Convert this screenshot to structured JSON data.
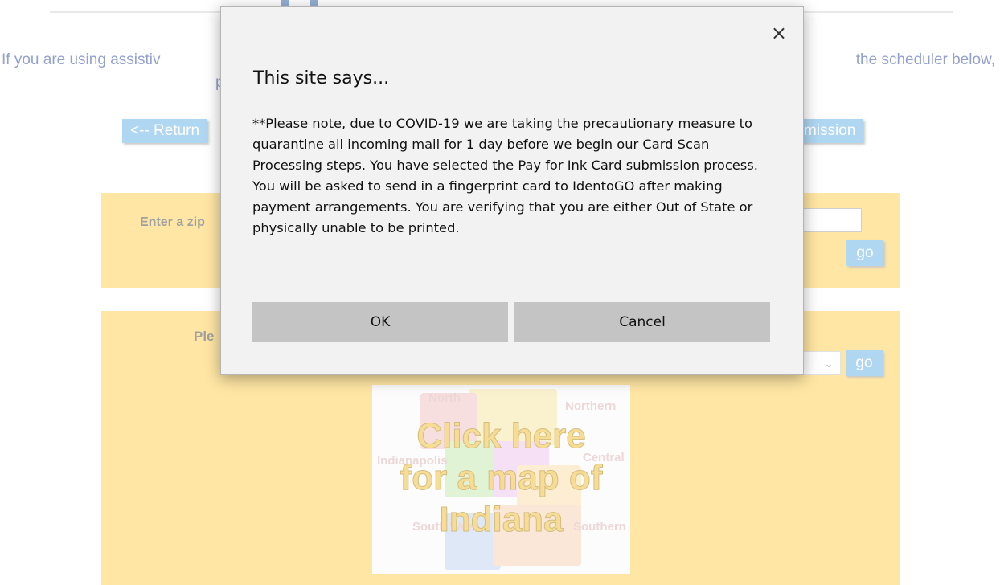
{
  "page": {
    "assist_left": "If you are using assistiv",
    "assist_right": "the scheduler below,",
    "assist_line2": "p",
    "return_button": "<-- Return",
    "submission_button": "mission",
    "zip_label": "Enter a zip",
    "zip_go": "go",
    "region_label": "Ple",
    "region_period": ".",
    "region_go": "go",
    "map": {
      "line1": "Click here",
      "line2": "for a map of",
      "line3": "Indiana",
      "regions": [
        "North",
        "Northern",
        "Indianapolis",
        "Central",
        "South West",
        "Southern"
      ]
    }
  },
  "dialog": {
    "title": "This site says...",
    "message": "**Please note, due to COVID-19 we are taking the precautionary measure to quarantine all incoming mail for 1 day before we begin our Card Scan Processing steps. You have selected the Pay for Ink Card submission process. You will be asked to send in a fingerprint card to IdentoGO after making payment arrangements. You are verifying that you are either Out of State or physically unable to be printed.",
    "ok_label": "OK",
    "cancel_label": "Cancel",
    "close_icon": "×"
  },
  "colors": {
    "panel": "#ffd25a",
    "button": "#6fb7e8",
    "link_text": "#3a55a8",
    "dialog_bg": "#f2f2f2",
    "dialog_button": "#c4c4c4"
  }
}
